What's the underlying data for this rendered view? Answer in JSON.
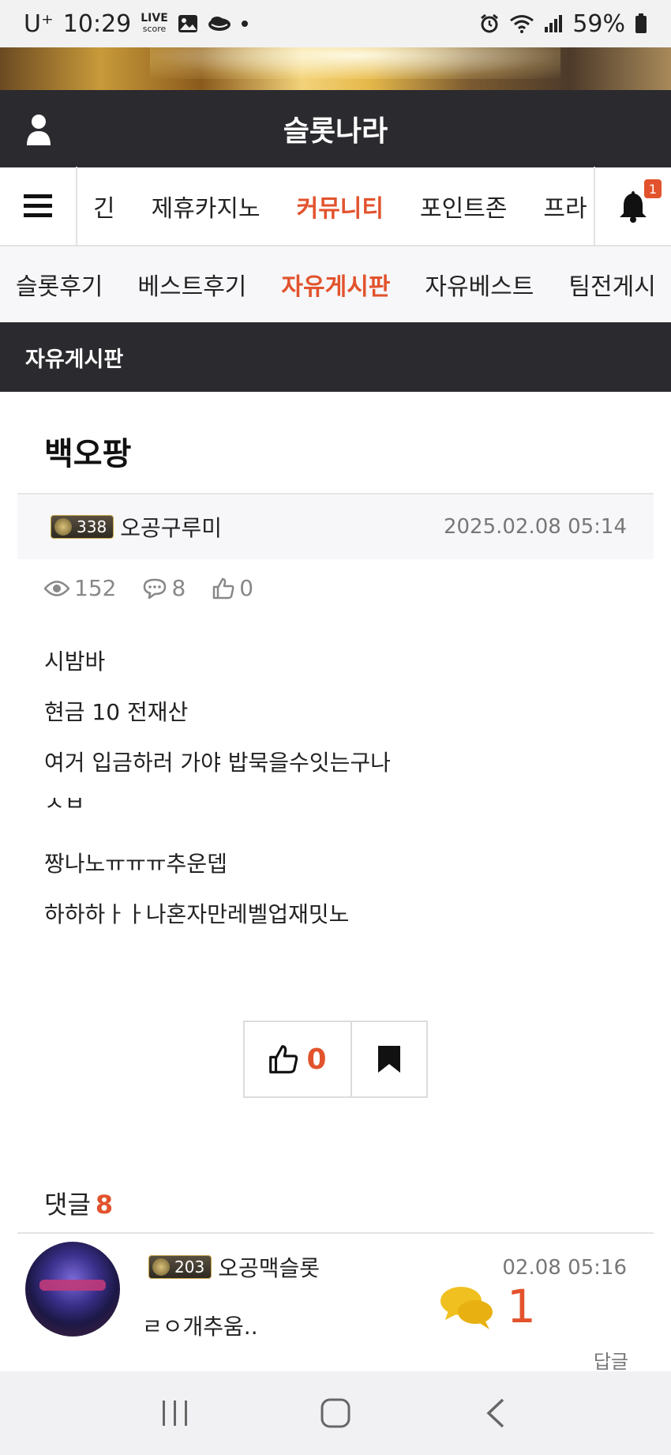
{
  "status_bar": {
    "carrier": "U⁺",
    "time": "10:29",
    "live_label": "LIVE",
    "live_sub": "score",
    "battery": "59%"
  },
  "header": {
    "title": "슬롯나라"
  },
  "main_nav": {
    "items": [
      {
        "label": "긴"
      },
      {
        "label": "제휴카지노"
      },
      {
        "label": "커뮤니티",
        "active": true
      },
      {
        "label": "포인트존"
      },
      {
        "label": "프라"
      }
    ],
    "notification_count": "1"
  },
  "sub_nav": {
    "items": [
      {
        "label": "슬롯후기"
      },
      {
        "label": "베스트후기"
      },
      {
        "label": "자유게시판",
        "active": true
      },
      {
        "label": "자유베스트"
      },
      {
        "label": "팀전게시"
      }
    ]
  },
  "board": {
    "title": "자유게시판"
  },
  "post": {
    "title": "백오팡",
    "author_level": "338",
    "author": "오공구루미",
    "date": "2025.02.08 05:14",
    "views": "152",
    "comments": "8",
    "likes": "0",
    "lines": [
      "시밤바",
      "현금 10 전재산",
      "여거 입금하러 가야 밥묵을수잇는구나",
      "ㅅㅂ",
      "짱나노ㅠㅠㅠ추운뎁",
      "하하하ㅏㅏ나혼자만레벨업재밋노"
    ],
    "like_button_count": "0"
  },
  "comments": {
    "label": "댓글",
    "count": "8",
    "items": [
      {
        "level": "203",
        "author": "오공맥슬롯",
        "date": "02.08 05:16",
        "text": "ㄹㅇ개추움..",
        "reply_label": "답글"
      }
    ]
  },
  "floating_chat": {
    "count": "1"
  },
  "colors": {
    "accent": "#e2532d",
    "header_bg": "#2b2a2e"
  }
}
